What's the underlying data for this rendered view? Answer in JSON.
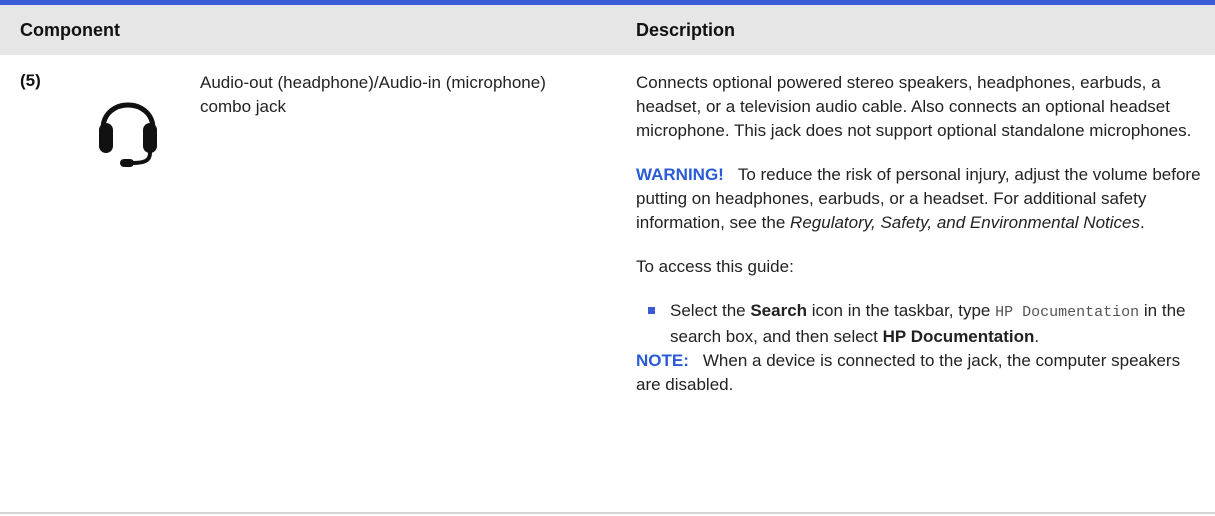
{
  "table": {
    "headers": {
      "component": "Component",
      "description": "Description"
    },
    "row": {
      "number": "(5)",
      "icon": "headphone-icon",
      "component_name": "Audio-out (headphone)/Audio-in (microphone) combo jack",
      "description": "Connects optional powered stereo speakers, headphones, earbuds, a headset, or a television audio cable. Also connects an optional headset microphone. This jack does not support optional standalone microphones.",
      "warning": {
        "label": "WARNING!",
        "text": "To reduce the risk of personal injury, adjust the volume before putting on headphones, earbuds, or a headset. For additional safety information, see the",
        "guide_title": "Regulatory, Safety, and Environmental Notices",
        "end": "."
      },
      "access_text": "To access this guide:",
      "bullet": {
        "part1": "Select the",
        "search_label": "Search",
        "part2": "icon in the taskbar, type",
        "code": "HP Documentation",
        "part3": "in the search box, and then select",
        "hp_doc": "HP Documentation",
        "end": "."
      },
      "note": {
        "label": "NOTE:",
        "text": "When a device is connected to the jack, the computer speakers are disabled."
      }
    }
  },
  "colors": {
    "accent": "#3b5bd6",
    "header_bg": "#e6e6e6",
    "label_blue": "#2a5bd7"
  }
}
